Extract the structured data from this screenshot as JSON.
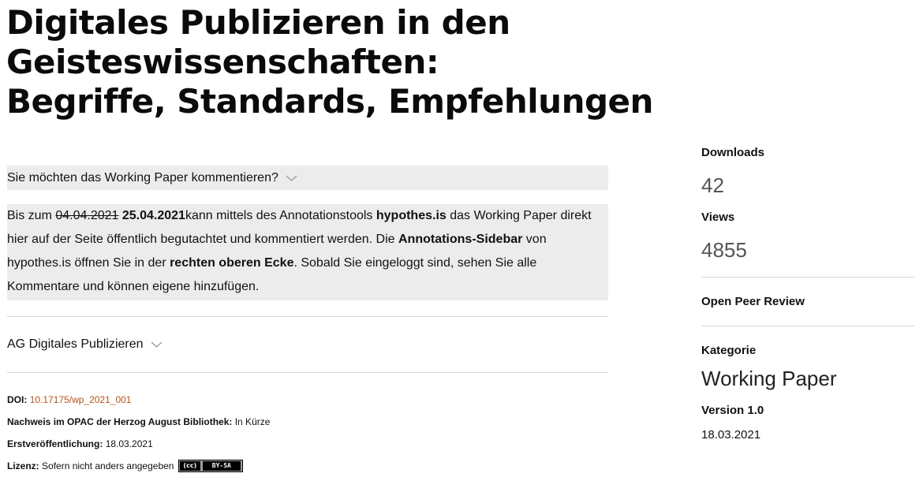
{
  "title": {
    "line1": "Digitales Publizieren in den Geisteswissenschaften:",
    "line2": "Begriffe, Standards, Empfehlungen"
  },
  "comment_section": {
    "heading": "Sie möchten das Working Paper kommentieren?",
    "text_before": "Bis zum ",
    "old_date": "04.04.2021",
    "new_date": "25.04.2021",
    "text_1": "kann mittels des Annotationstools ",
    "tool_name": "hypothes.is",
    "text_2": " das Working Paper direkt hier auf der Seite öffentlich begutachtet und kommentiert werden. Die ",
    "sidebar_name": "Annotations-Sidebar",
    "text_3": " von hypothes.is öffnen Sie in der ",
    "corner_name": "rechten oberen Ecke",
    "text_4": ". Sobald Sie eingeloggt sind, sehen Sie alle Kommentare und können eigene hinzufügen."
  },
  "ag_section": {
    "label": "AG Digitales Publizieren"
  },
  "meta": {
    "doi_key": "DOI:",
    "doi_value": "10.17175/wp_2021_001",
    "opac_key": "Nachweis im OPAC der Herzog August Bibliothek:",
    "opac_value": "In Kürze",
    "first_pub_key": "Erstveröffentlichung:",
    "first_pub_value": "18.03.2021",
    "license_key": "Lizenz:",
    "license_value": "Sofern nicht anders angegeben",
    "license_badge_left": "(cc)",
    "license_badge_right": "BY-SA"
  },
  "sidebar": {
    "downloads_label": "Downloads",
    "downloads_value": "42",
    "views_label": "Views",
    "views_value": "4855",
    "peer_review_label": "Open Peer Review",
    "category_label": "Kategorie",
    "category_value": "Working Paper",
    "version_label": "Version 1.0",
    "version_date": "18.03.2021"
  },
  "colors": {
    "link": "#b3541e",
    "panel_bg": "#ececec",
    "divider": "#d6d6d6"
  }
}
